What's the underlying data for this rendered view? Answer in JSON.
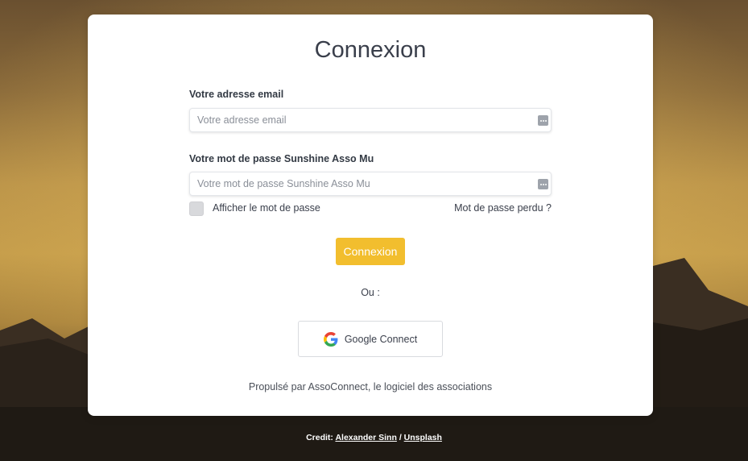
{
  "page": {
    "title": "Connexion"
  },
  "email": {
    "label": "Votre adresse email",
    "placeholder": "Votre adresse email",
    "value": ""
  },
  "password": {
    "label": "Votre mot de passe Sunshine Asso Mu",
    "placeholder": "Votre mot de passe Sunshine Asso Mu",
    "value": ""
  },
  "show_password": {
    "label": "Afficher le mot de passe",
    "checked": false
  },
  "lost_password_link": "Mot de passe perdu ?",
  "submit_label": "Connexion",
  "separator": "Ou :",
  "google": {
    "label": "Google Connect",
    "icon": "google-g-icon"
  },
  "powered_by": "Propulsé par AssoConnect, le logiciel des associations",
  "credit": {
    "prefix": "Credit:",
    "author": "Alexander Sinn",
    "separator": "/",
    "source": "Unsplash"
  },
  "colors": {
    "accent": "#f2be2e",
    "title": "#3a3f4b",
    "card": "#ffffff"
  }
}
